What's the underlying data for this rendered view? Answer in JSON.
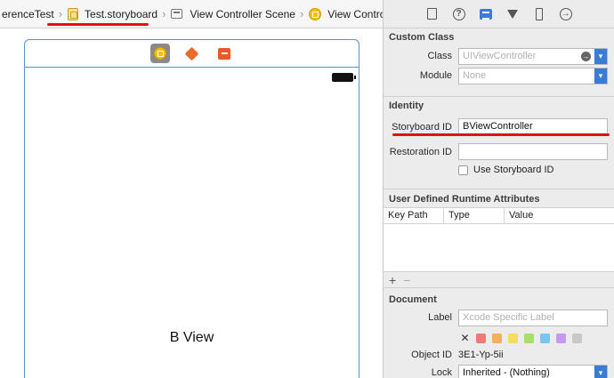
{
  "breadcrumb": {
    "items": [
      {
        "label": "erenceTest"
      },
      {
        "label": "Test.storyboard"
      },
      {
        "label": "View Controller Scene"
      },
      {
        "label": "View Controller"
      }
    ]
  },
  "canvas": {
    "view_label": "B View"
  },
  "inspector": {
    "custom_class": {
      "title": "Custom Class",
      "class_label": "Class",
      "class_placeholder": "UIViewController",
      "module_label": "Module",
      "module_placeholder": "None"
    },
    "identity": {
      "title": "Identity",
      "storyboard_id_label": "Storyboard ID",
      "storyboard_id_value": "BViewController",
      "restoration_id_label": "Restoration ID",
      "restoration_id_value": "",
      "use_storyboard_id_label": "Use Storyboard ID"
    },
    "runtime_attributes": {
      "title": "User Defined Runtime Attributes",
      "columns": [
        "Key Path",
        "Type",
        "Value"
      ],
      "add_symbol": "+",
      "remove_symbol": "−"
    },
    "document": {
      "title": "Document",
      "label_label": "Label",
      "label_placeholder": "Xcode Specific Label",
      "clear_symbol": "✕",
      "swatch_colors": [
        "#f07a7a",
        "#f5b05a",
        "#f2dd5c",
        "#a8df6a",
        "#79c7f0",
        "#c39af0",
        "#c8c8c8"
      ],
      "object_id_label": "Object ID",
      "object_id_value": "3E1-Yp-5ii",
      "lock_label": "Lock",
      "lock_value": "Inherited - (Nothing)"
    }
  },
  "annotation_color": "#e01111"
}
